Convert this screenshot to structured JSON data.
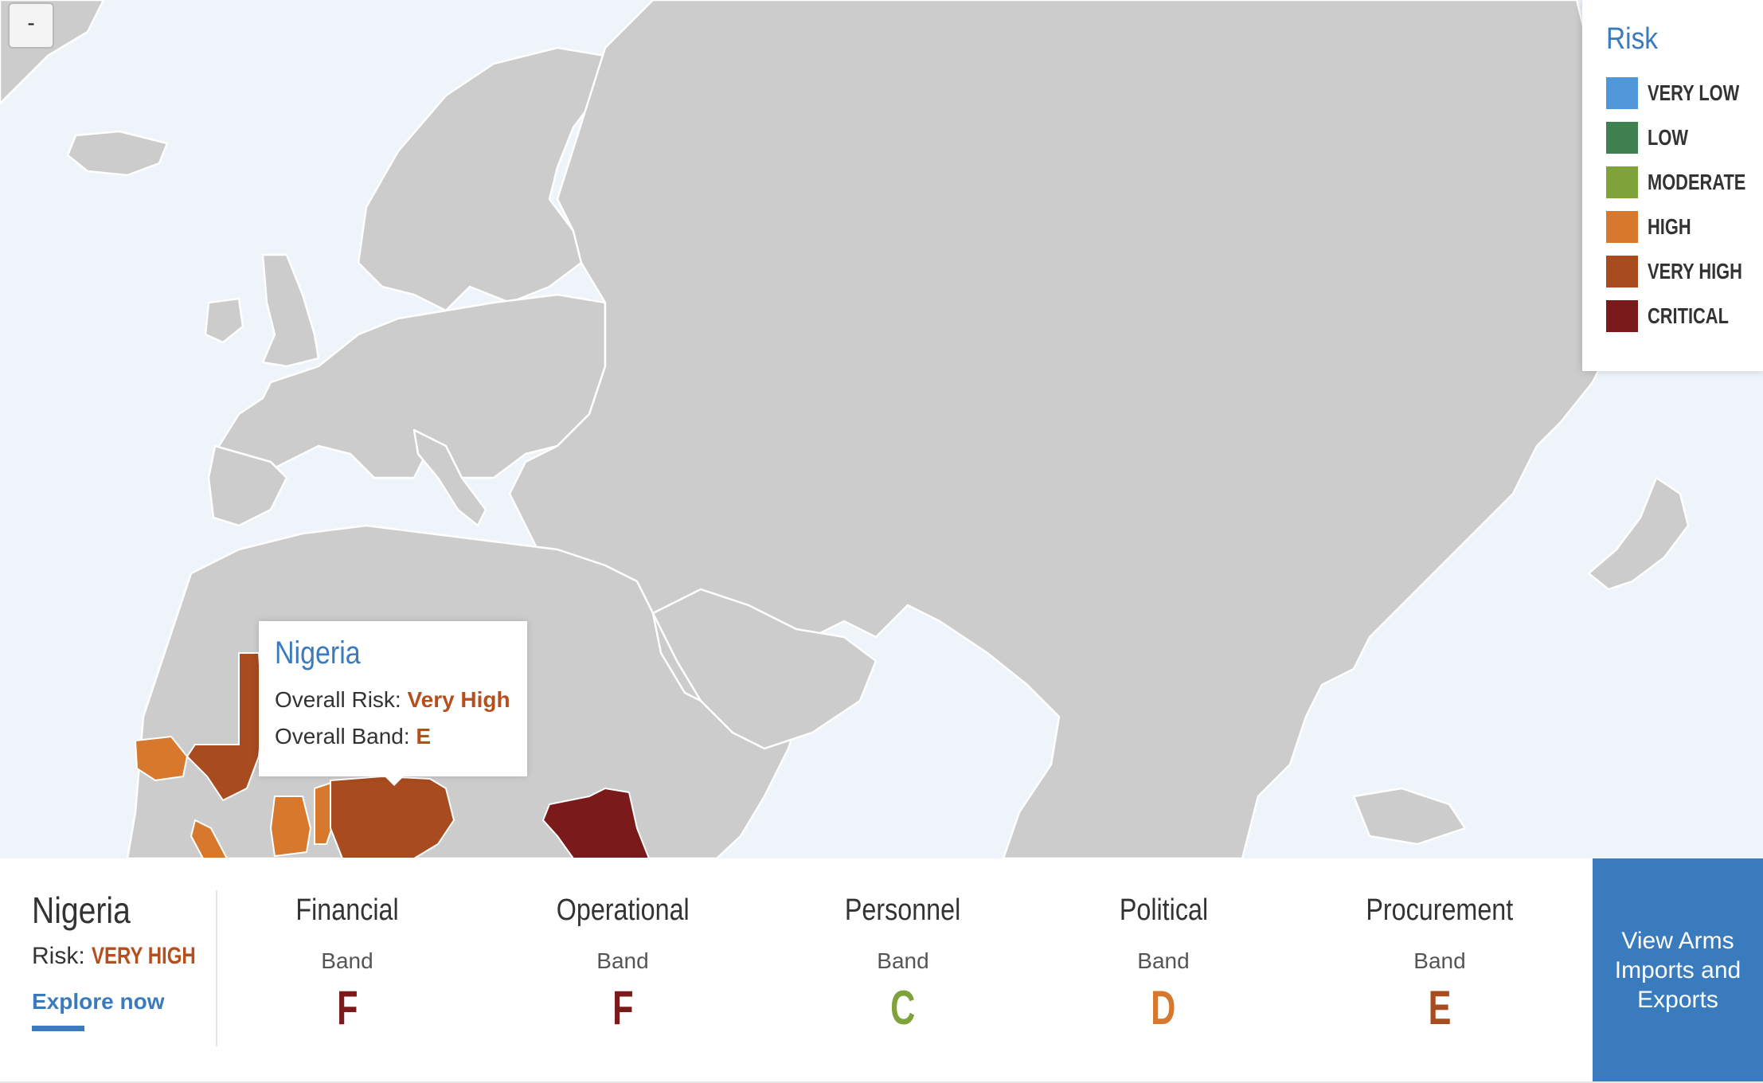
{
  "map": {
    "zoom_out_label": "-"
  },
  "legend": {
    "title": "Risk",
    "items": [
      {
        "label": "VERY LOW",
        "color": "#4f97d8"
      },
      {
        "label": "LOW",
        "color": "#3f8050"
      },
      {
        "label": "MODERATE",
        "color": "#7fa23a"
      },
      {
        "label": "HIGH",
        "color": "#d8782c"
      },
      {
        "label": "VERY HIGH",
        "color": "#a84b1f"
      },
      {
        "label": "CRITICAL",
        "color": "#7a1a1a"
      }
    ]
  },
  "tooltip": {
    "country": "Nigeria",
    "risk_label": "Overall Risk:",
    "risk_value": "Very High",
    "band_label": "Overall Band:",
    "band_value": "E"
  },
  "panel": {
    "country": "Nigeria",
    "risk_label": "Risk:",
    "risk_value": "VERY HIGH",
    "explore_label": "Explore now",
    "band_label": "Band",
    "categories": [
      {
        "name": "Financial",
        "grade": "F",
        "color": "#7a1a1a"
      },
      {
        "name": "Operational",
        "grade": "F",
        "color": "#7a1a1a"
      },
      {
        "name": "Personnel",
        "grade": "C",
        "color": "#7fa23a"
      },
      {
        "name": "Political",
        "grade": "D",
        "color": "#d8782c"
      },
      {
        "name": "Procurement",
        "grade": "E",
        "color": "#a84b1f"
      }
    ],
    "view_button_label": "View Arms Imports and Exports"
  }
}
